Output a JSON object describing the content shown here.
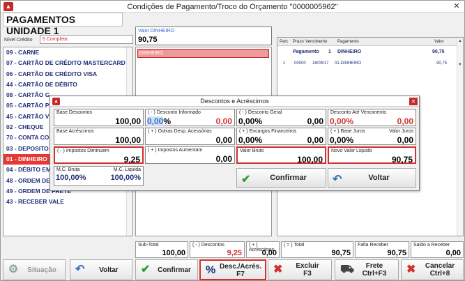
{
  "window": {
    "title": "Condições de Pagamento/Troco do Orçamento \"0000005962\""
  },
  "header": {
    "title": "PAGAMENTOS UNIDADE 1"
  },
  "nivel": {
    "label": "Nível Crédito",
    "value": "5 Completa"
  },
  "valor": {
    "label": "Valor DINHEIRO",
    "value": "90,75"
  },
  "payment_methods": [
    {
      "label": "09 - CARNE"
    },
    {
      "label": "07 - CARTÃO DE CRÉDITO MASTERCARD"
    },
    {
      "label": "06 - CARTÃO DE CRÉDITO VISA"
    },
    {
      "label": "44 - CARTÃO DE DÉBITO"
    },
    {
      "label": "08 - CARTÃO G"
    },
    {
      "label": "05 - CARTÃO P"
    },
    {
      "label": "45 - CARTÃO V"
    },
    {
      "label": "02 - CHEQUE"
    },
    {
      "label": "70 - CONTA CO"
    },
    {
      "label": "03 - DEPOSITO"
    },
    {
      "label": "01 - DINHEIRO"
    },
    {
      "label": "04 - DÉBITO EM"
    },
    {
      "label": "48 - ORDEM DE"
    },
    {
      "label": "49 - ORDEM DE FRETE"
    },
    {
      "label": "43 - RECEBER VALE"
    }
  ],
  "selected_list": {
    "item": "DINHEIRO"
  },
  "parcelas": {
    "headers": {
      "parc": "Parc",
      "prazo": "Prazo",
      "vencimento": "Vencimento",
      "pagamento": "Pagamento",
      "valor": "Valor"
    },
    "summary": {
      "label": "Pagamento",
      "num": "1",
      "method": "DINHEIRO",
      "valor": "90,75"
    },
    "row": {
      "parc": "1",
      "prazo": "00000",
      "vencimento": "18/09/17",
      "pagamento": "01-DINHEIRO",
      "valor": "90,75"
    }
  },
  "dialog": {
    "title": "Descontos e Acréscimos",
    "base_descontos": {
      "label": "Base Descontos",
      "value": "100,00"
    },
    "desconto_informado": {
      "label": "( - ) Desconto Informado",
      "pct": "0,00",
      "pct_suffix": "%",
      "value": "0,00"
    },
    "desconto_geral": {
      "label": "( - ) Desconto Geral",
      "pct": "0,00%",
      "value": "0,00"
    },
    "desconto_ate_venc": {
      "label": "Desconto Até Vencimento",
      "pct": "0,00%",
      "value": "0,00"
    },
    "base_acrescimos": {
      "label": "Base Acréscimos",
      "value": "100,00"
    },
    "outras_desp": {
      "label": "( + ) Outras Desp. Acessórias",
      "value": "0,00"
    },
    "encargos": {
      "label": "( + ) Encargos Financeiros",
      "pct": "0,00%",
      "value": "0,00"
    },
    "base_juros": {
      "label": "( + ) Base Juros",
      "label2": "Valor Juros",
      "pct": "0,00%",
      "value": "0,00"
    },
    "impostos_dim": {
      "label": "( - ) Impostos Diminuem",
      "value": "9,25"
    },
    "impostos_aum": {
      "label": "( + ) Impostos Aumentam",
      "value": "0,00"
    },
    "valor_bruto": {
      "label": "Valor Bruto",
      "value": "100,00"
    },
    "novo_valor": {
      "label": "Novo Valor Liquido",
      "value": "90,75"
    },
    "mc": {
      "label_bruta": "M.C. Bruta",
      "label_liquida": "M.C. Liquida",
      "bruta": "100,00%",
      "liquida": "100,00%"
    },
    "confirm_label": "Confirmar",
    "back_label": "Voltar"
  },
  "totals": {
    "subtotal": {
      "label": "Sub-Total",
      "value": "100,00"
    },
    "descontos": {
      "label": "( - ) Descontos",
      "value": "9,25"
    },
    "acrescimos": {
      "label": "( + ) Acréscimos",
      "value": "0,00"
    },
    "total": {
      "label": "( = ) Total",
      "value": "90,75"
    },
    "falta": {
      "label": "Falta Receber",
      "value": "90,75"
    },
    "saldo": {
      "label": "Saldo a Receber",
      "value": "0,00"
    }
  },
  "buttons": {
    "situacao": "Situação",
    "voltar": "Voltar",
    "confirmar": "Confirmar",
    "desc_l1": "Desc./Acrés.",
    "desc_l2": "F7",
    "excluir_l1": "Excluir",
    "excluir_l2": "F3",
    "frete_l1": "Frete",
    "frete_l2": "Ctrl+F3",
    "cancelar_l1": "Cancelar",
    "cancelar_l2": "Ctrl+8"
  },
  "colors": {
    "accent": "#d32f2f",
    "navy": "#1f2f7a",
    "link": "#3a6fd0"
  }
}
